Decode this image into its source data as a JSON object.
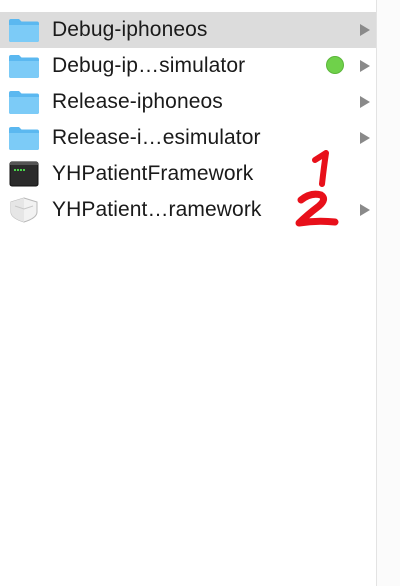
{
  "finder": {
    "items": [
      {
        "label": "Debug-iphoneos",
        "icon": "folder-icon",
        "selected": true,
        "has_arrow": true,
        "tag": null
      },
      {
        "label": "Debug-ip…simulator",
        "icon": "folder-icon",
        "selected": false,
        "has_arrow": true,
        "tag": "green"
      },
      {
        "label": "Release-iphoneos",
        "icon": "folder-icon",
        "selected": false,
        "has_arrow": true,
        "tag": null
      },
      {
        "label": "Release-i…esimulator",
        "icon": "folder-icon",
        "selected": false,
        "has_arrow": true,
        "tag": null
      },
      {
        "label": "YHPatientFramework",
        "icon": "terminal-executable-icon",
        "selected": false,
        "has_arrow": false,
        "tag": null
      },
      {
        "label": "YHPatient…ramework",
        "icon": "framework-bundle-icon",
        "selected": false,
        "has_arrow": true,
        "tag": null
      }
    ]
  },
  "colors": {
    "selection": "#dcdcdc",
    "folder": "#6cc2f5",
    "tag_green": "#6fd14a",
    "annotation_red": "#e8101a"
  }
}
